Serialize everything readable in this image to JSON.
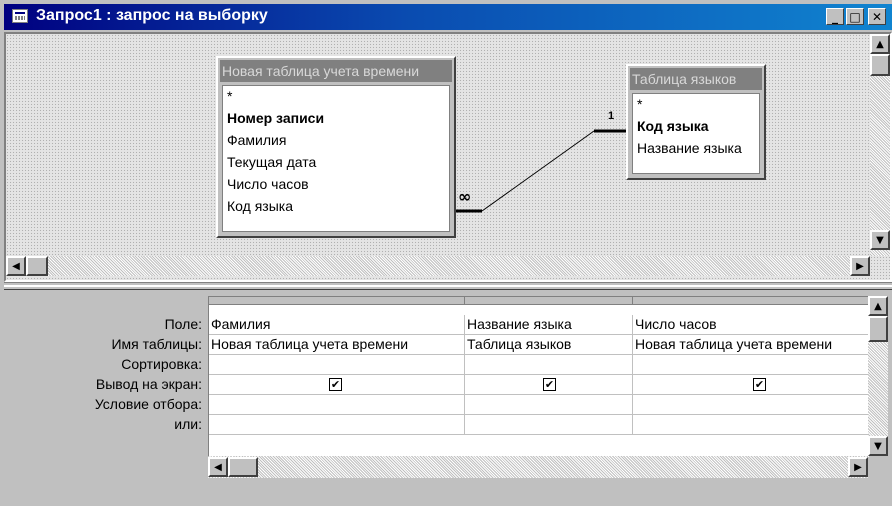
{
  "window": {
    "title": "Запрос1 : запрос на выборку",
    "icon": "query-icon",
    "buttons": {
      "minimize": "_",
      "maximize": "□",
      "close": "✕"
    }
  },
  "tables": [
    {
      "title": "Новая таблица учета времени",
      "fields": [
        {
          "name": "*",
          "bold": false
        },
        {
          "name": "Номер записи",
          "bold": true
        },
        {
          "name": "Фамилия",
          "bold": false
        },
        {
          "name": "Текущая дата",
          "bold": false
        },
        {
          "name": "Число часов",
          "bold": false
        },
        {
          "name": "Код языка",
          "bold": false
        }
      ]
    },
    {
      "title": "Таблица языков",
      "fields": [
        {
          "name": "*",
          "bold": false
        },
        {
          "name": "Код языка",
          "bold": true
        },
        {
          "name": "Название языка",
          "bold": false
        }
      ]
    }
  ],
  "relationship": {
    "one_label": "1",
    "many_label": "∞"
  },
  "grid": {
    "row_labels": [
      "Поле:",
      "Имя таблицы:",
      "Сортировка:",
      "Вывод на экран:",
      "Условие отбора:",
      "или:"
    ],
    "columns": [
      {
        "field": "Фамилия",
        "table": "Новая таблица учета времени",
        "sort": "",
        "show": true,
        "criteria": "",
        "or": ""
      },
      {
        "field": "Название языка",
        "table": "Таблица языков",
        "sort": "",
        "show": true,
        "criteria": "",
        "or": ""
      },
      {
        "field": "Число часов",
        "table": "Новая таблица учета времени",
        "sort": "",
        "show": true,
        "criteria": "",
        "or": ""
      }
    ],
    "checkmark": "✔"
  },
  "scroll_glyphs": {
    "up": "▲",
    "down": "▼",
    "left": "◀",
    "right": "▶"
  }
}
